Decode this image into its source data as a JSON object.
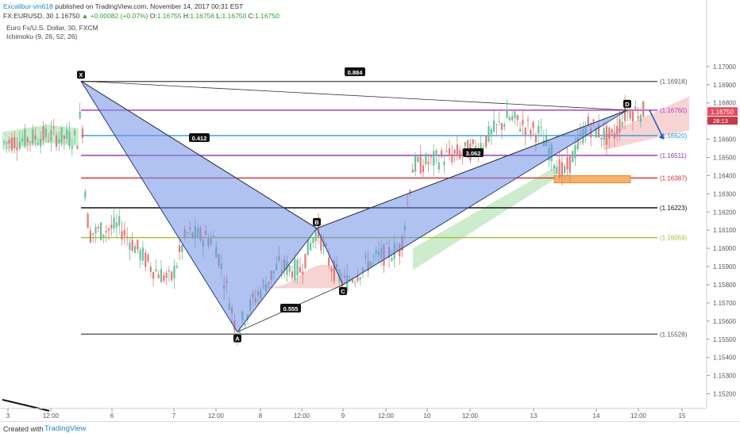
{
  "header": {
    "author": "Excalibur-vin618",
    "published": "published on TradingView.com, November 14, 2017 00:31 EST",
    "symbol": "FX:EURUSD, 30",
    "last": "1.16750",
    "change": "+0.00082 (+0.07%)",
    "o_label": "O:",
    "o": "1.16755",
    "h_label": "H:",
    "h": "1.16756",
    "l_label": "L:",
    "l": "1.16750",
    "c_label": "C:",
    "c": "1.16750"
  },
  "legend": {
    "instrument": "Euro Fx/U.S. Dollar, 30, FXCM",
    "indicator": "Ichimoku (9, 26, 52, 26)"
  },
  "footer": {
    "created": "Created with",
    "brand": "TradingView"
  },
  "colors": {
    "pattern_fill": "#6f8fe6",
    "up_candle": "#6bbf9a",
    "down_candle": "#e07a7a",
    "cloud_green": "#b8e4b8",
    "cloud_red": "#f4c2c2",
    "price_label": "#e84c5d",
    "arrow": "#1e5fbf"
  },
  "chart_data": {
    "type": "candlestick",
    "symbol": "FX:EURUSD",
    "timeframe": "30",
    "ylim": [
      1.1515,
      1.172
    ],
    "y_ticks": [
      "1.17000",
      "1.16900",
      "1.16800",
      "1.16700",
      "1.16600",
      "1.16500",
      "1.16400",
      "1.16300",
      "1.16200",
      "1.16100",
      "1.16000",
      "1.15900",
      "1.15800",
      "1.15700",
      "1.15600",
      "1.15500",
      "1.15400",
      "1.15300",
      "1.15200"
    ],
    "x_ticks": [
      "3",
      "12:00",
      "6",
      "7",
      "12:00",
      "8",
      "12:00",
      "9",
      "12:00",
      "10",
      "12:00",
      "13",
      "14",
      "12:00",
      "15"
    ],
    "current_price": "1.16750",
    "countdown": "28:13",
    "pattern_points": [
      {
        "label": "X",
        "price": 1.1692
      },
      {
        "label": "A",
        "price": 1.1554
      },
      {
        "label": "B",
        "price": 1.1611
      },
      {
        "label": "C",
        "price": 1.158
      },
      {
        "label": "D",
        "price": 1.1676
      }
    ],
    "ratios": [
      "0.884",
      "0.412",
      "0.555",
      "3.062"
    ],
    "levels": [
      {
        "price": 1.16918,
        "label": "1.16918",
        "color": "#555555"
      },
      {
        "price": 1.1676,
        "label": "1.16760",
        "color": "#b23fc1"
      },
      {
        "price": 1.1662,
        "label": "1.16620",
        "color": "#2b9ad6"
      },
      {
        "price": 1.16511,
        "label": "1.16511",
        "color": "#8d2fb0"
      },
      {
        "price": 1.16387,
        "label": "1.16387",
        "color": "#d62b2b"
      },
      {
        "price": 1.16223,
        "label": "1.16223",
        "color": "#111111"
      },
      {
        "price": 1.16059,
        "label": "1.16059",
        "color": "#9bc12d"
      },
      {
        "price": 1.15528,
        "label": "1.15528",
        "color": "#555555"
      }
    ],
    "target_zone": {
      "from": 1.1636,
      "to": 1.164
    }
  }
}
